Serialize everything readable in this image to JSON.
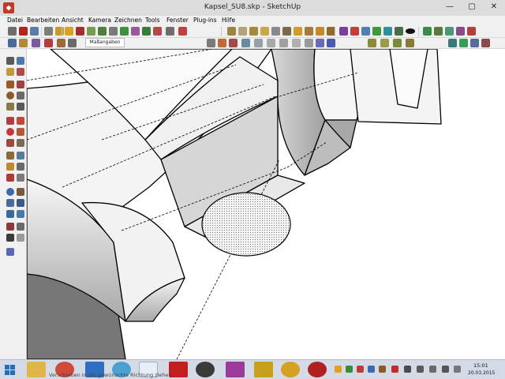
{
  "window": {
    "title": "Kapsel_SU8.skp - SketchUp",
    "minimize": "—",
    "maximize": "▢",
    "close": "✕"
  },
  "menu": [
    "Datei",
    "Bearbeiten",
    "Ansicht",
    "Kamera",
    "Zeichnen",
    "Tools",
    "Fenster",
    "Plug-ins",
    "Hilfe"
  ],
  "tabs": {
    "dimensions": "Maßangaben"
  },
  "status": {
    "hint": "Verschieben in die gewünschte Richtung ziehen"
  },
  "clock": {
    "time": "15:01",
    "date": "20.03.2015"
  },
  "colors": {
    "chrome": "#f0f0f0",
    "titlebar": "#dcdcdc",
    "taskbar": "#d4dbe6",
    "model_face": "#ffffff",
    "model_shadow": "#777777",
    "hole_fill": "#e8e8e8"
  },
  "icons": {
    "main_toolbar": [
      "new-file-icon",
      "open-icon",
      "save-icon",
      "cut-icon",
      "copy-icon",
      "paste-icon",
      "erase-icon",
      "undo-icon",
      "redo-icon",
      "print-icon",
      "model-info-icon",
      "select-icon",
      "paint-icon",
      "push-pull-icon",
      "move-icon",
      "rotate-icon",
      "scale-icon",
      "offset-icon",
      "tape-icon",
      "text-icon",
      "axes-icon",
      "dimension-icon",
      "protractor-icon",
      "section-icon",
      "orbit-icon",
      "pan-icon",
      "zoom-icon",
      "zoom-extents-icon"
    ],
    "view_toolbar": [
      "iso-view-icon",
      "top-view-icon",
      "front-view-icon",
      "right-view-icon",
      "back-view-icon",
      "left-view-icon",
      "xray-icon",
      "wireframe-icon",
      "hidden-line-icon",
      "shaded-icon",
      "textured-icon",
      "monochrome-icon",
      "shadow-icon",
      "fog-icon",
      "edge-style-icon",
      "layer-icon"
    ],
    "taskbar_apps": [
      "file-explorer-icon",
      "chrome-icon",
      "calendar-icon",
      "internet-explorer-icon",
      "sketchup-icon",
      "acrobat-icon",
      "media-icon",
      "photo-icon",
      "game-icon",
      "headset-icon",
      "camera-icon"
    ]
  }
}
